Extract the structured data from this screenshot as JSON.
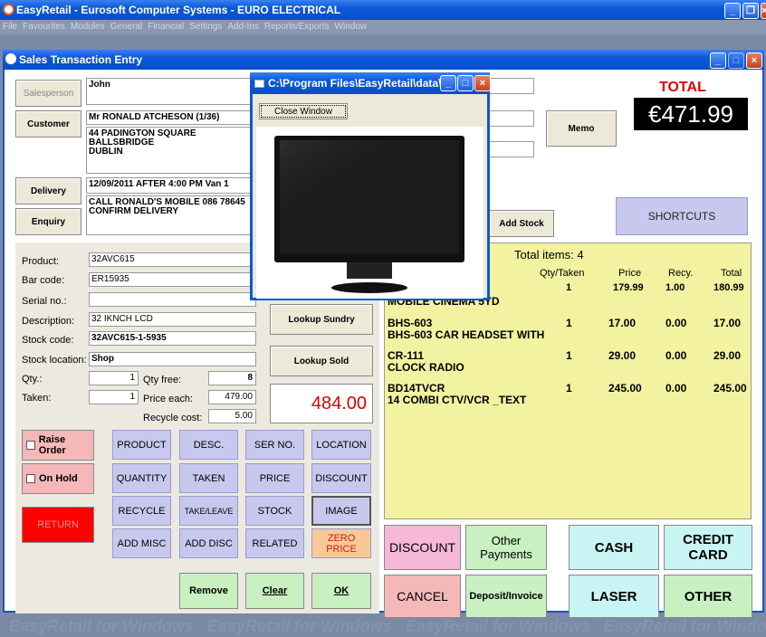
{
  "app": {
    "title": "EasyRetail - Eurosoft Computer Systems - EURO ELECTRICAL",
    "menu": [
      "File",
      "Favourites",
      "Modules",
      "General",
      "Financial",
      "Settings",
      "Add-Ins",
      "Reports/Exports",
      "Window"
    ]
  },
  "window": {
    "title": "Sales Transaction Entry"
  },
  "popup": {
    "title": "C:\\Program Files\\EasyRetail\\data\\...",
    "close_label": "Close Window"
  },
  "left_buttons": {
    "salesperson": "Salesperson",
    "customer": "Customer",
    "delivery": "Delivery",
    "enquiry": "Enquiry"
  },
  "salesperson": "John",
  "customer": {
    "name": "Mr RONALD ATCHESON (1/36)",
    "address": [
      "44 PADINGTON SQUARE",
      "BALLSBRIDGE",
      "DUBLIN"
    ]
  },
  "delivery": {
    "date": "12/09/2011 AFTER 4:00 PM Van 1",
    "notes": [
      "CALL RONALD'S MOBILE 086 78645",
      "CONFIRM DELIVERY"
    ]
  },
  "memo_label": "Memo",
  "total": {
    "label": "TOTAL",
    "value": "€471.99"
  },
  "add_stock_label": "Add Stock",
  "shortcuts_label": "SHORTCUTS",
  "product": {
    "labels": {
      "product": "Product:",
      "barcode": "Bar code:",
      "serial": "Serial no.:",
      "description": "Description:",
      "stockcode": "Stock code:",
      "location": "Stock location:",
      "qty": "Qty.:",
      "taken": "Taken:",
      "qtyfree": "Qty free:",
      "price_each": "Price each:",
      "recycle_cost": "Recycle cost:"
    },
    "product": "32AVC615",
    "barcode": "ER15935",
    "serial": "",
    "description": "32 IKNCH LCD",
    "stockcode": "32AVC615-1-5935",
    "location": "Shop",
    "qty": "1",
    "taken": "1",
    "qtyfree": "8",
    "price_each": "479.00",
    "recycle_cost": "5.00"
  },
  "lookup_sundry": "Lookup Sundry",
  "lookup_sold": "Lookup Sold",
  "line_total": "484.00",
  "cart": {
    "total_items": "Total items: 4",
    "headers": {
      "qty": "Qty/Taken",
      "price": "Price",
      "recy": "Recy.",
      "total": "Total"
    },
    "first_row": {
      "qty": "1",
      "price": "179.99",
      "recy": "1.00",
      "total": "180.99",
      "desc": "MOBILE CINEMA 5YD"
    },
    "items": [
      {
        "code": "BHS-603",
        "desc": "BHS-603 CAR HEADSET WITH",
        "qty": "1",
        "price": "17.00",
        "recy": "0.00",
        "total": "17.00"
      },
      {
        "code": "CR-111",
        "desc": "CLOCK RADIO",
        "qty": "1",
        "price": "29.00",
        "recy": "0.00",
        "total": "29.00"
      },
      {
        "code": "BD14TVCR",
        "desc": "14 COMBI CTV/VCR _TEXT",
        "qty": "1",
        "price": "245.00",
        "recy": "0.00",
        "total": "245.00"
      }
    ]
  },
  "checks": {
    "raise_order": "Raise Order",
    "on_hold": "On Hold",
    "return": "RETURN"
  },
  "grid": [
    [
      "PRODUCT",
      "DESC.",
      "SER NO.",
      "LOCATION"
    ],
    [
      "QUANTITY",
      "TAKEN",
      "PRICE",
      "DISCOUNT"
    ],
    [
      "RECYCLE",
      "TAKE/LEAVE",
      "STOCK",
      "IMAGE"
    ],
    [
      "ADD MISC",
      "ADD DISC",
      "RELATED",
      "ZERO PRICE"
    ]
  ],
  "actions": {
    "remove": "Remove",
    "clear": "Clear",
    "ok": "OK"
  },
  "pay": {
    "discount": "DISCOUNT",
    "other_payments": "Other Payments",
    "cash": "CASH",
    "credit_card": "CREDIT CARD",
    "cancel": "CANCEL",
    "deposit": "Deposit/Invoice",
    "laser": "LASER",
    "other": "OTHER"
  },
  "watermark": "EasyRetail for Windows"
}
